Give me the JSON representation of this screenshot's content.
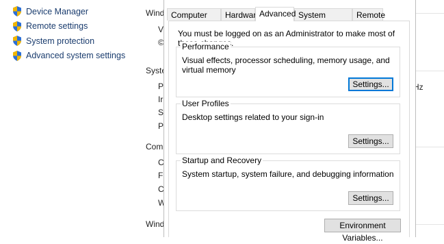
{
  "left_nav": {
    "items": [
      {
        "label": "Device Manager",
        "icon": "shield-icon"
      },
      {
        "label": "Remote settings",
        "icon": "shield-icon"
      },
      {
        "label": "System protection",
        "icon": "shield-icon"
      },
      {
        "label": "Advanced system settings",
        "icon": "shield-icon"
      }
    ]
  },
  "background": {
    "fragments": [
      "Wind",
      "Syste",
      "Com",
      "Wind"
    ],
    "clipped_chars": [
      "V",
      "©",
      "P",
      "Ir",
      "S",
      "P",
      "C",
      "F",
      "C",
      "W"
    ],
    "right_fragment": "Hz"
  },
  "dialog": {
    "tabs": [
      "Computer Name",
      "Hardware",
      "Advanced",
      "System Protection",
      "Remote"
    ],
    "active_tab": "Advanced",
    "admin_note": "You must be logged on as an Administrator to make most of these changes.",
    "groups": [
      {
        "title": "Performance",
        "desc": "Visual effects, processor scheduling, memory usage, and virtual memory",
        "button": "Settings..."
      },
      {
        "title": "User Profiles",
        "desc": "Desktop settings related to your sign-in",
        "button": "Settings..."
      },
      {
        "title": "Startup and Recovery",
        "desc": "System startup, system failure, and debugging information",
        "button": "Settings..."
      }
    ],
    "env_button": "Environment Variables..."
  },
  "colors": {
    "link": "#1a3c6e",
    "button_bg": "#e1e1e1",
    "focus": "#0078d7"
  }
}
